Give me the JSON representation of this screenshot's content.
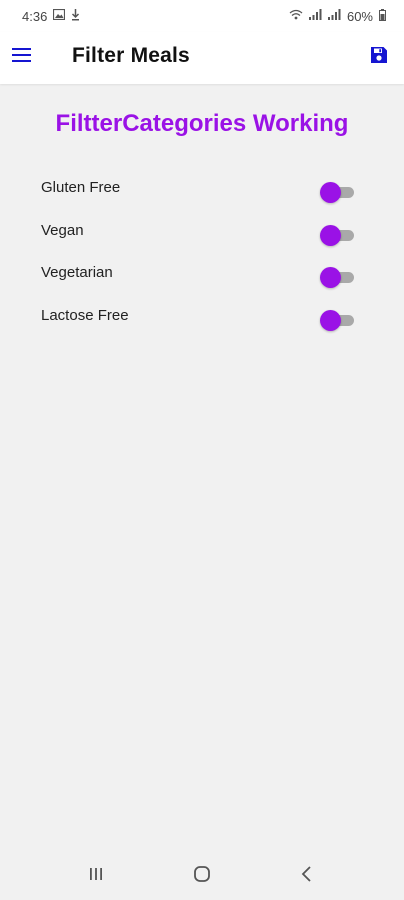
{
  "status_bar": {
    "time": "4:36",
    "battery": "60%",
    "icons": [
      "image-icon",
      "download-icon",
      "wifi-icon",
      "signal-icon",
      "signal-icon",
      "battery-icon"
    ]
  },
  "app_bar": {
    "title": "Filter Meals",
    "menu_icon": "hamburger-menu-icon",
    "save_icon": "save-icon",
    "accent": "#1515d1"
  },
  "main": {
    "heading": "FiltterCategories Working",
    "heading_color": "#9a12e6",
    "filters": [
      {
        "label": "Gluten Free",
        "enabled": true
      },
      {
        "label": "Vegan",
        "enabled": true
      },
      {
        "label": "Vegetarian",
        "enabled": true
      },
      {
        "label": "Lactose Free",
        "enabled": true
      }
    ]
  },
  "nav_bar": {
    "buttons": [
      "recent-apps-icon",
      "home-icon",
      "back-icon"
    ]
  }
}
